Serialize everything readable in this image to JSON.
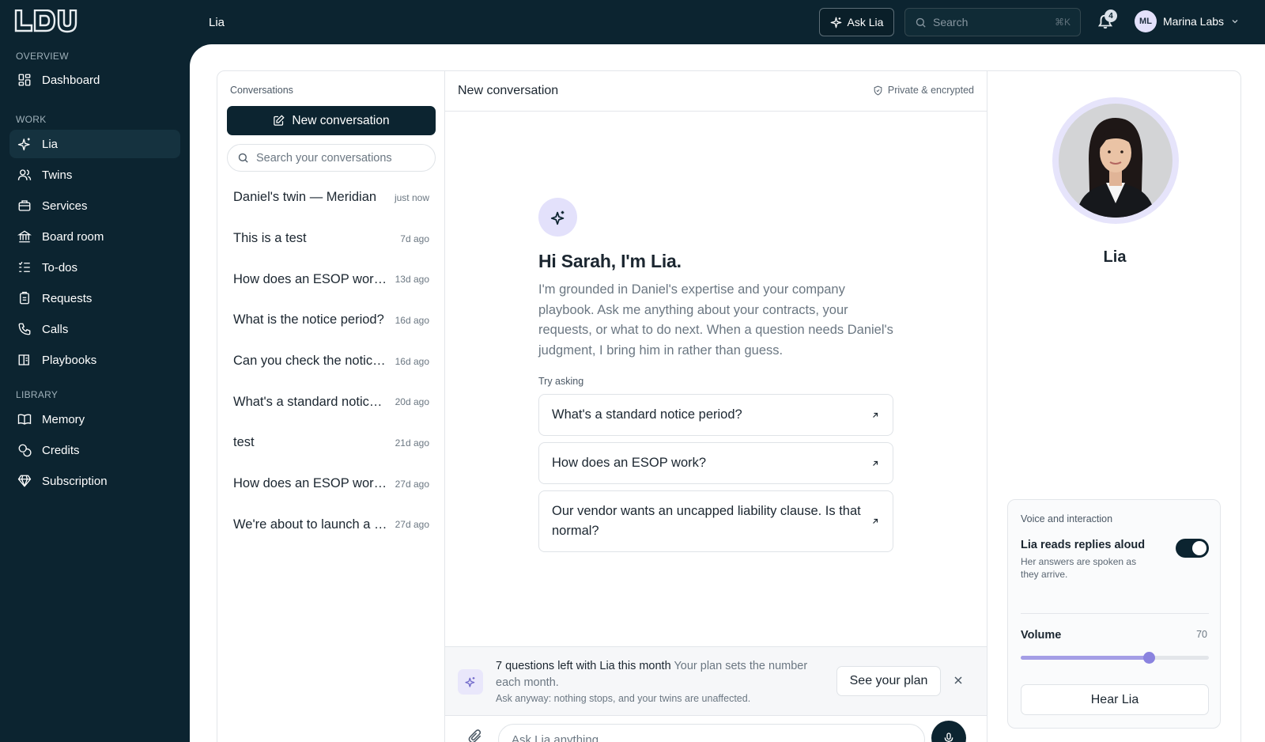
{
  "topbar": {
    "logo_text": "LDU",
    "breadcrumb": "Lia",
    "ask_label": "Ask Lia",
    "search_placeholder": "Search",
    "search_shortcut": "⌘K",
    "notification_count": "4",
    "user_initials": "ML",
    "user_name": "Marina Labs"
  },
  "sidebar": {
    "sections": [
      "OVERVIEW",
      "WORK",
      "LIBRARY"
    ],
    "items": [
      {
        "label": "Dashboard",
        "icon": "grid-icon"
      },
      {
        "label": "Lia",
        "icon": "sparkle-icon",
        "active": true
      },
      {
        "label": "Twins",
        "icon": "users-icon"
      },
      {
        "label": "Services",
        "icon": "briefcase-icon"
      },
      {
        "label": "Board room",
        "icon": "bank-icon"
      },
      {
        "label": "To-dos",
        "icon": "checklist-icon"
      },
      {
        "label": "Requests",
        "icon": "clipboard-icon"
      },
      {
        "label": "Calls",
        "icon": "phone-icon"
      },
      {
        "label": "Playbooks",
        "icon": "book-open-icon"
      },
      {
        "label": "Memory",
        "icon": "book-icon"
      },
      {
        "label": "Credits",
        "icon": "coins-icon"
      },
      {
        "label": "Subscription",
        "icon": "gem-icon"
      }
    ]
  },
  "conversations": {
    "heading": "Conversations",
    "new_label": "New conversation",
    "search_placeholder": "Search your conversations",
    "items": [
      {
        "title": "Daniel's twin — Meridian",
        "time": "just now"
      },
      {
        "title": "This is a test",
        "time": "7d ago"
      },
      {
        "title": "How does an ESOP work?",
        "time": "13d ago"
      },
      {
        "title": "What is the notice period?",
        "time": "16d ago"
      },
      {
        "title": "Can you check the notice period?",
        "time": "16d ago"
      },
      {
        "title": "What's a standard notice period?",
        "time": "20d ago"
      },
      {
        "title": "test",
        "time": "21d ago"
      },
      {
        "title": "How does an ESOP work?",
        "time": "27d ago"
      },
      {
        "title": "We're about to launch a new product",
        "time": "27d ago"
      }
    ]
  },
  "chat": {
    "title": "New conversation",
    "privacy": "Private & encrypted",
    "greeting": "Hi Sarah, I'm Lia.",
    "intro": "I'm grounded in Daniel's expertise and your company playbook. Ask me anything about your contracts, your requests, or what to do next. When a question needs Daniel's judgment, I bring him in rather than guess.",
    "try_label": "Try asking",
    "suggestions": [
      "What's a standard notice period?",
      "How does an ESOP work?",
      "Our vendor wants an uncapped liability clause. Is that normal?"
    ],
    "quota_count": "7 questions left with Lia this month",
    "quota_detail": "Your plan sets the number each month.",
    "quota_sub": "Ask anyway: nothing stops, and your twins are unaffected.",
    "plan_label": "See your plan",
    "composer_placeholder": "Ask Lia anything"
  },
  "profile": {
    "name": "Lia",
    "voice_title": "Voice and interaction",
    "read_aloud_label": "Lia reads replies aloud",
    "read_aloud_desc": "Her answers are spoken as they arrive.",
    "read_aloud_on": true,
    "volume_label": "Volume",
    "volume_value": "70",
    "volume_level": 0.68,
    "hear_label": "Hear Lia"
  },
  "colors": {
    "navy": "#0c2430",
    "accent": "#8a83df",
    "accent_soft": "#e3e1fb"
  }
}
